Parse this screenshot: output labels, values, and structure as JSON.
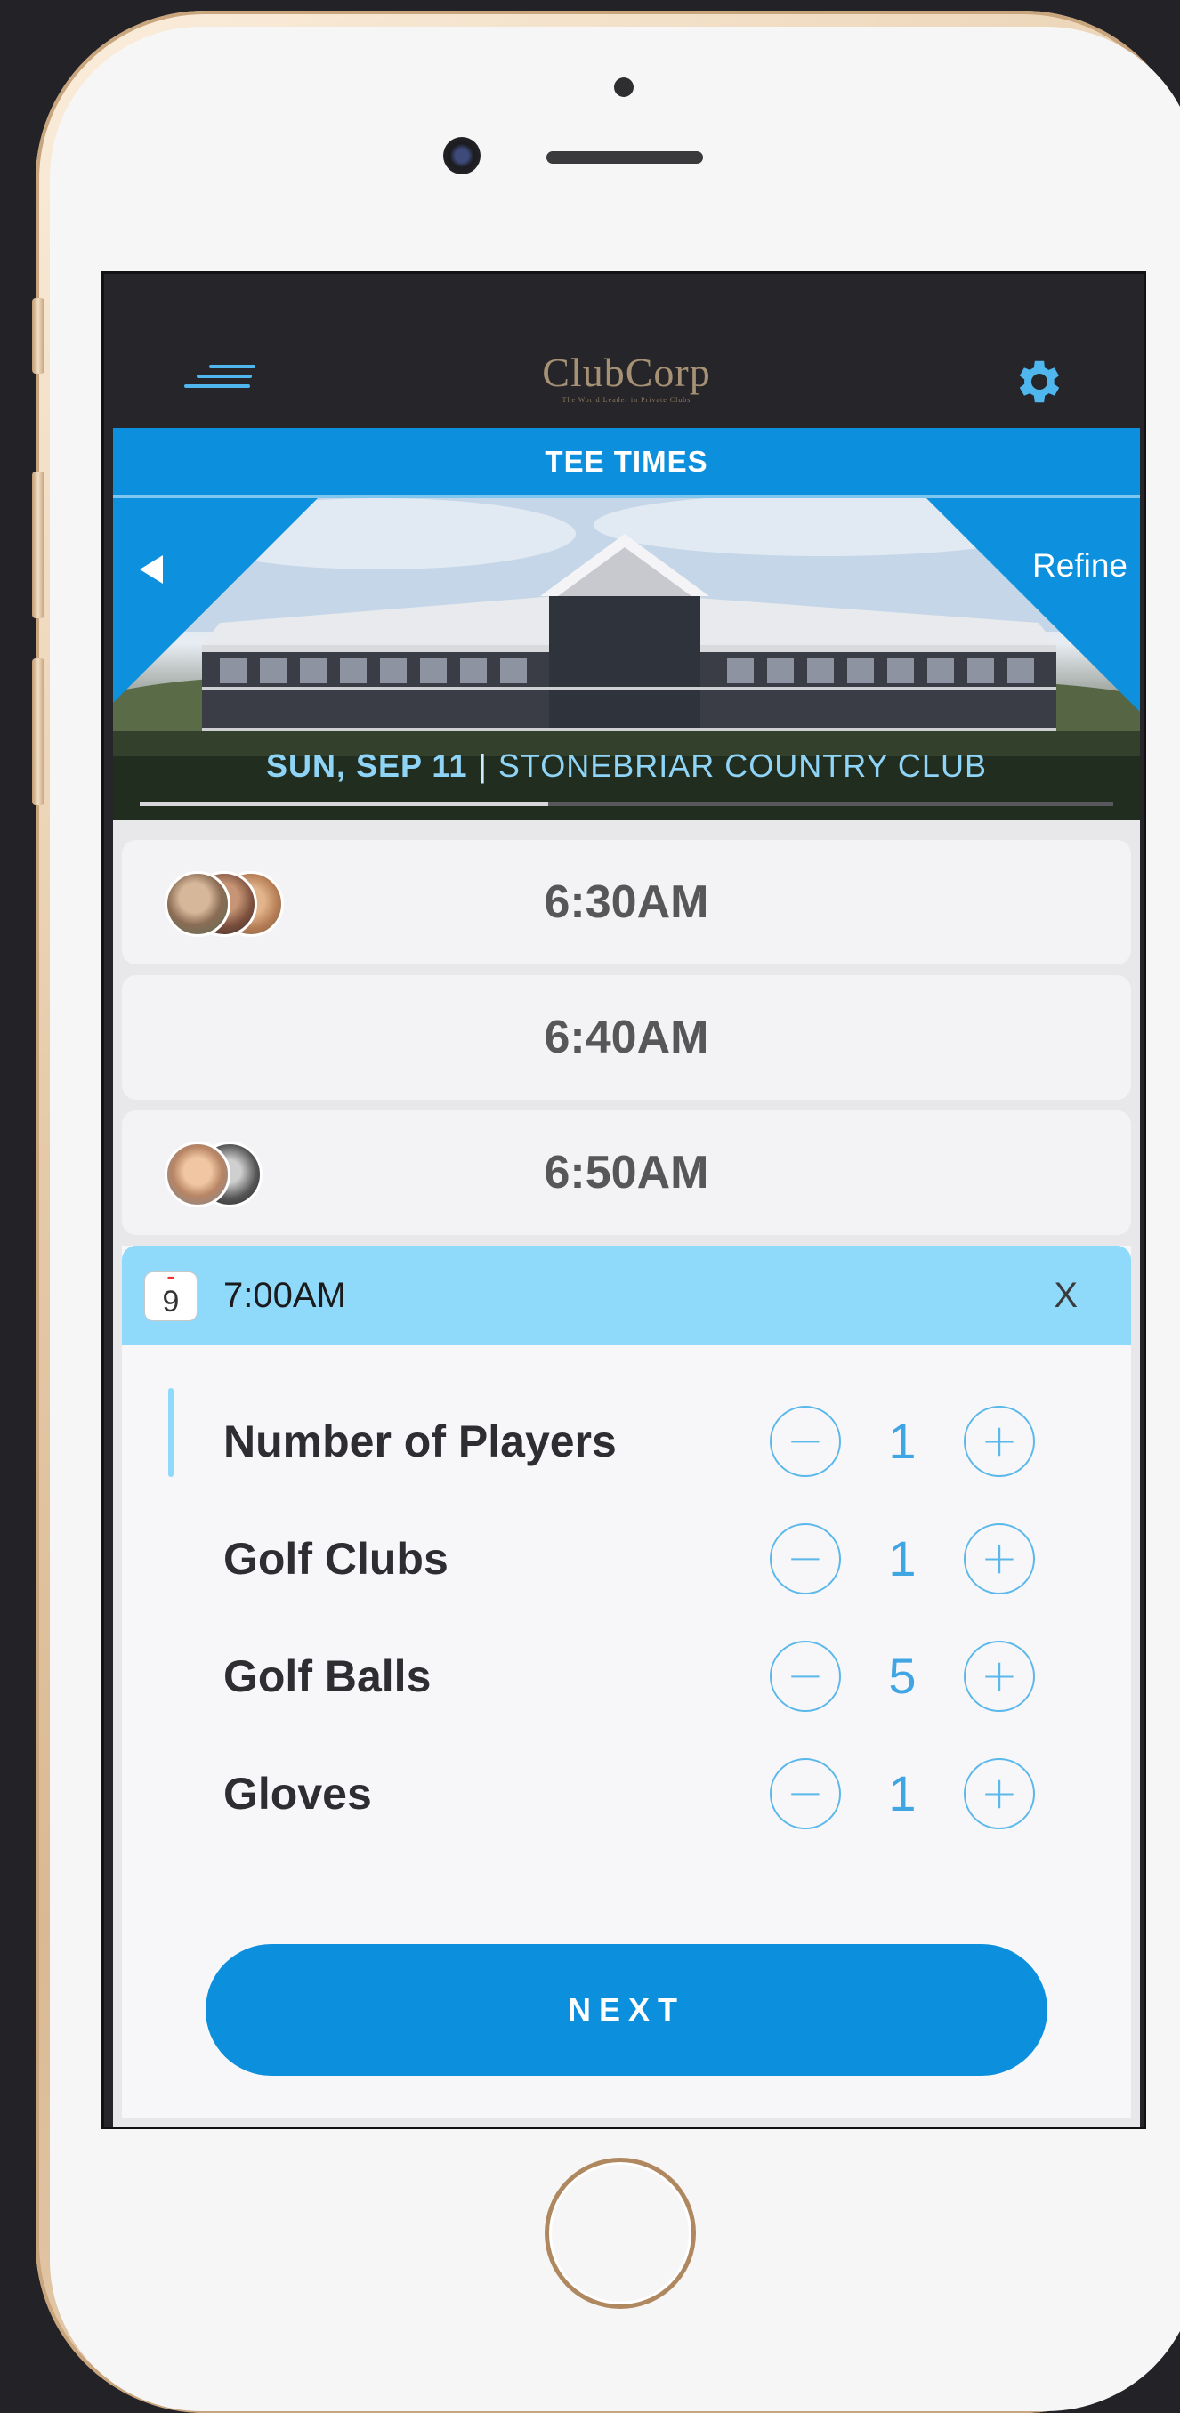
{
  "app": {
    "logo_main": "ClubCorp",
    "logo_tagline": "The World Leader in Private Clubs",
    "page_title": "TEE TIMES"
  },
  "hero": {
    "date": "SUN, SEP 11",
    "separator": "|",
    "club_name": "STONEBRIAR COUNTRY CLUB",
    "refine_label": "Refine",
    "carousel_progress": 0.42
  },
  "tee_times": [
    {
      "time": "6:30AM",
      "players_shown": 3
    },
    {
      "time": "6:40AM",
      "players_shown": 0
    },
    {
      "time": "6:50AM",
      "players_shown": 2
    }
  ],
  "selected": {
    "calendar_day": "9",
    "time": "7:00AM",
    "close_label": "X",
    "options": [
      {
        "label": "Number of Players",
        "value": "1"
      },
      {
        "label": "Golf Clubs",
        "value": "1"
      },
      {
        "label": "Golf Balls",
        "value": "5"
      },
      {
        "label": "Gloves",
        "value": "1"
      }
    ],
    "decrement_symbol": "−",
    "increment_symbol": "+",
    "next_label": "NEXT"
  },
  "colors": {
    "brand_blue": "#0c8fdc",
    "light_blue": "#8fdafa",
    "logo_gold": "#a69174"
  }
}
